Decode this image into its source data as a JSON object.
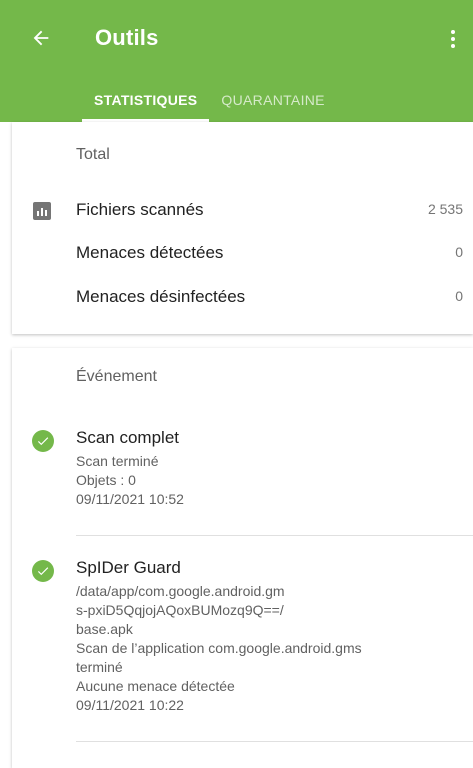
{
  "colors": {
    "accent": "#74b84a",
    "background": "#f5f5f5"
  },
  "header": {
    "title": "Outils",
    "back_icon": "arrow-left-icon",
    "menu_icon": "more-vert-icon",
    "tabs": [
      {
        "label": "STATISTIQUES",
        "active": true
      },
      {
        "label": "QUARANTAINE",
        "active": false
      }
    ]
  },
  "stats": {
    "section_title": "Total",
    "icon": "bar-chart-icon",
    "rows": [
      {
        "label": "Fichiers scannés",
        "value": "2 535"
      },
      {
        "label": "Menaces détectées",
        "value": "0"
      },
      {
        "label": "Menaces désinfectées",
        "value": "0"
      }
    ]
  },
  "events": {
    "section_title": "Événement",
    "items": [
      {
        "icon": "check-circle-icon",
        "title": "Scan complet",
        "lines": [
          "Scan terminé",
          "Objets : 0",
          "09/11/2021 10:52"
        ]
      },
      {
        "icon": "check-circle-icon",
        "title": "SpIDer Guard",
        "lines": [
          "/data/app/com.google.android.gm",
          "s-pxiD5QqjojAQoxBUMozq9Q==/",
          "base.apk",
          "Scan de l’application com.google.android.gms",
          "terminé",
          "Aucune menace détectée",
          "09/11/2021 10:22"
        ]
      }
    ]
  }
}
